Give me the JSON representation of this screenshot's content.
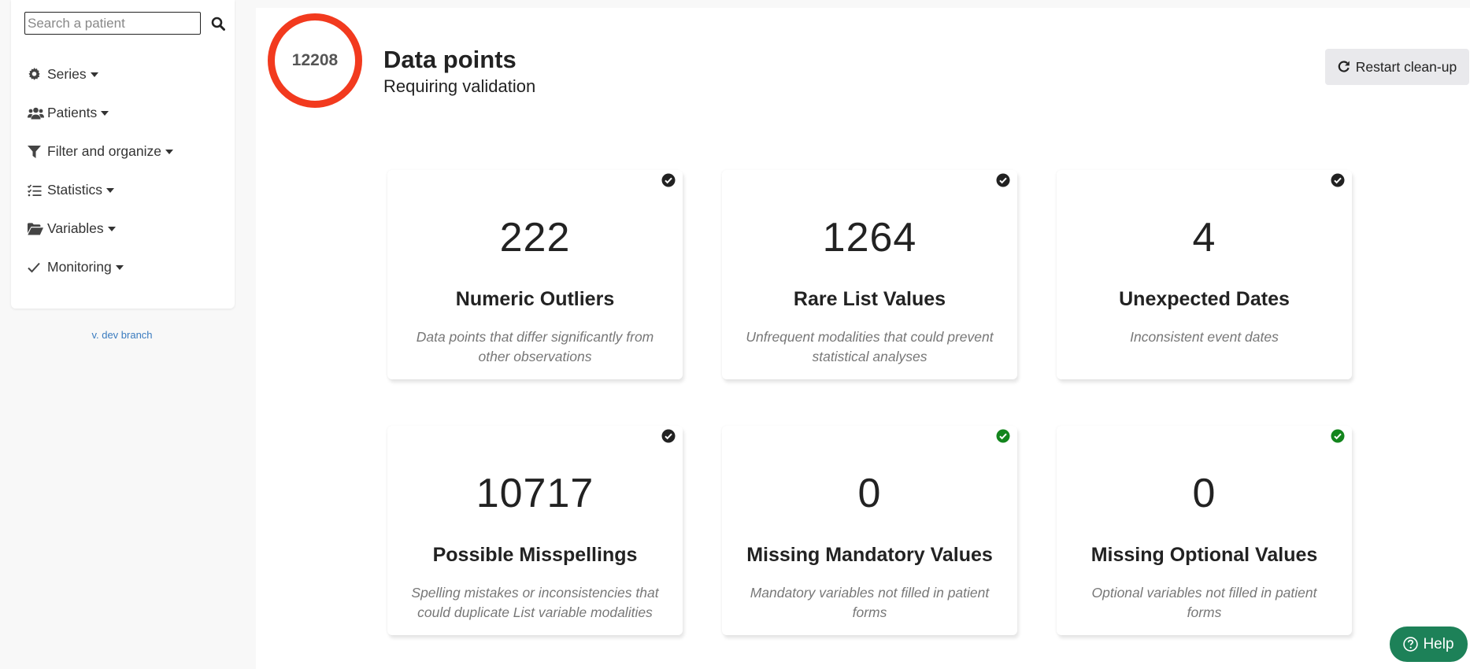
{
  "sidebar": {
    "search": {
      "placeholder": "Search a patient",
      "value": ""
    },
    "items": [
      {
        "label": "Series",
        "icon": "gear-icon"
      },
      {
        "label": "Patients",
        "icon": "users-icon"
      },
      {
        "label": "Filter and organize",
        "icon": "filter-icon"
      },
      {
        "label": "Statistics",
        "icon": "list-check-icon"
      },
      {
        "label": "Variables",
        "icon": "folder-open-icon"
      },
      {
        "label": "Monitoring",
        "icon": "check-icon"
      }
    ],
    "version": "v. dev branch"
  },
  "header": {
    "total": "12208",
    "title": "Data points",
    "subtitle": "Requiring validation",
    "restart_label": "Restart clean-up"
  },
  "cards": [
    {
      "value": "222",
      "title": "Numeric Outliers",
      "desc": "Data points that differ significantly from other observations",
      "status": "done-dark"
    },
    {
      "value": "1264",
      "title": "Rare List Values",
      "desc": "Unfrequent modalities that could prevent statistical analyses",
      "status": "done-dark"
    },
    {
      "value": "4",
      "title": "Unexpected Dates",
      "desc": "Inconsistent event dates",
      "status": "done-dark"
    },
    {
      "value": "10717",
      "title": "Possible Misspellings",
      "desc": "Spelling mistakes or inconsistencies that could duplicate List variable modalities",
      "status": "done-dark"
    },
    {
      "value": "0",
      "title": "Missing Mandatory Values",
      "desc": "Mandatory variables not filled in patient forms",
      "status": "done-green"
    },
    {
      "value": "0",
      "title": "Missing Optional Values",
      "desc": "Optional variables not filled in patient forms",
      "status": "done-green"
    }
  ],
  "help_label": "Help",
  "colors": {
    "ring": "#f23a1e",
    "check_dark": "#222222",
    "check_green": "#13851d",
    "help_bg": "#1d8158",
    "link": "#3a7bbf"
  }
}
